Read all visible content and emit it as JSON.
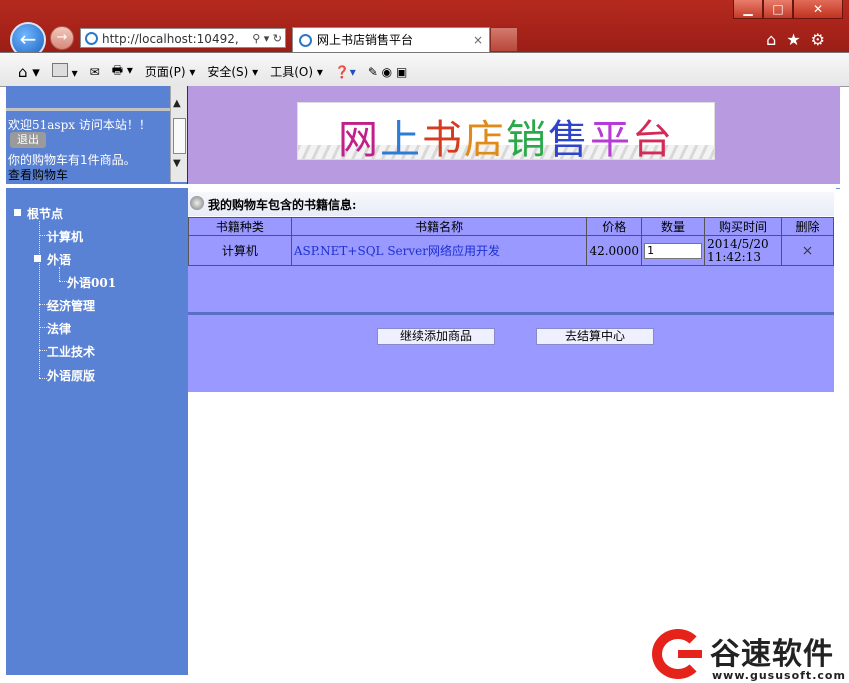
{
  "browser": {
    "address": "http://localhost:10492,",
    "tab_title": "网上书店销售平台",
    "window_buttons": {
      "minimize": "▁",
      "maximize": "□",
      "close": "✕"
    },
    "menus": [
      "页面(P)",
      "安全(S)",
      "工具(O)"
    ]
  },
  "header": {
    "welcome": "欢迎51aspx 访问本站！！",
    "logout": "退出",
    "cart_info": "你的购物车有1件商品。",
    "view_cart": "查看购物车",
    "banner_title": "网上书店销售平台",
    "banner_colors": [
      "#c0208a",
      "#2e7bd6",
      "#d63a1f",
      "#e08a1a",
      "#2aa84a",
      "#2f45c8",
      "#b73ad6",
      "#d42a58"
    ]
  },
  "sidebar": {
    "root": "根节点",
    "items": [
      "计算机",
      "外语",
      "外语001",
      "经济管理",
      "法律",
      "工业技术",
      "外语原版"
    ]
  },
  "cart": {
    "heading": "我的购物车包含的书籍信息:",
    "columns": [
      "书籍种类",
      "书籍名称",
      "价格",
      "数量",
      "购买时间",
      "删除"
    ],
    "rows": [
      {
        "category": "计算机",
        "name": "ASP.NET+SQL Server网络应用开发",
        "price": "42.0000",
        "quantity": "1",
        "date": "2014/5/20",
        "time": "11:42:13",
        "delete": "×"
      }
    ],
    "continue_button": "继续添加商品",
    "checkout_button": "去结算中心"
  },
  "watermark": {
    "brand": "谷速软件",
    "url": "www.gususoft.com"
  }
}
